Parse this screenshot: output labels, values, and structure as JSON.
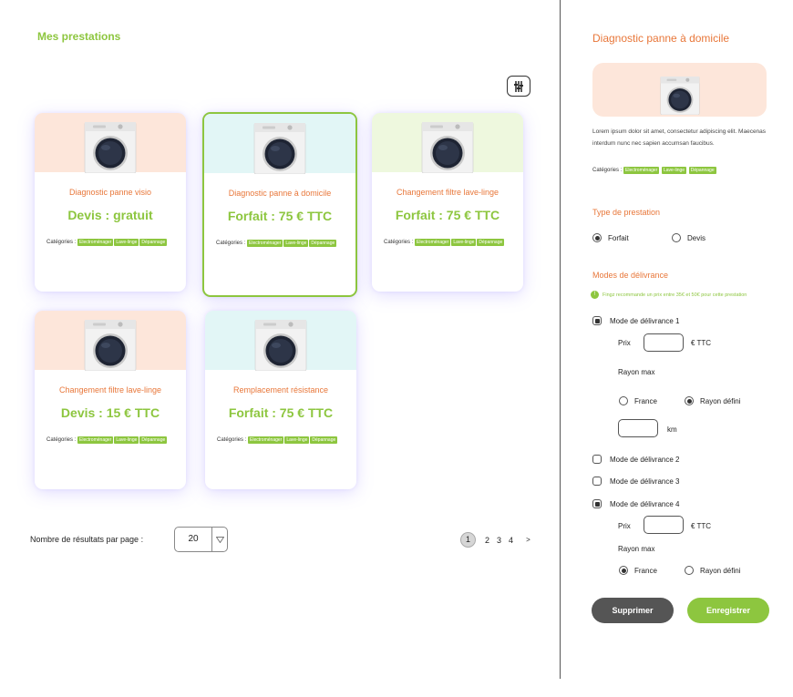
{
  "main": {
    "title": "Mes prestations",
    "filter_icon": "filter-sliders-icon",
    "cards": [
      {
        "name": "Diagnostic panne visio",
        "price": "Devis : gratuit",
        "cats_label": "Catégories :",
        "tags": [
          "Electroménager",
          "Lave-linge",
          "Dépannage"
        ],
        "header_color": "#fde6da",
        "selected": false
      },
      {
        "name": "Diagnostic panne à domicile",
        "price": "Forfait : 75 € TTC",
        "cats_label": "Catégories :",
        "tags": [
          "Electroménager",
          "Lave-linge",
          "Dépannage"
        ],
        "header_color": "#e2f6f6",
        "selected": true
      },
      {
        "name": "Changement filtre lave-linge",
        "price": "Forfait : 75 € TTC",
        "cats_label": "Catégories :",
        "tags": [
          "Electroménager",
          "Lave-linge",
          "Dépannage"
        ],
        "header_color": "#eef8de",
        "selected": false
      },
      {
        "name": "Changement filtre lave-linge",
        "price": "Devis : 15 € TTC",
        "cats_label": "Catégories :",
        "tags": [
          "Electroménager",
          "Lave-linge",
          "Dépannage"
        ],
        "header_color": "#fde6da",
        "selected": false
      },
      {
        "name": "Remplacement résistance",
        "price": "Forfait : 75 € TTC",
        "cats_label": "Catégories :",
        "tags": [
          "Electroménager",
          "Lave-linge",
          "Dépannage"
        ],
        "header_color": "#e2f6f6",
        "selected": false
      }
    ],
    "results_label": "Nombre de résultats par page :",
    "results_value": "20",
    "pagination": {
      "pages": [
        "1",
        "2",
        "3",
        "4"
      ],
      "current": "1",
      "next": ">"
    }
  },
  "side": {
    "title": "Diagnostic panne à domicile",
    "desc": "Lorem ipsum dolor sit amet, consectetur adipiscing elit. Maecenas interdum nunc nec sapien accumsan faucibus.",
    "cats_label": "Catégories :",
    "tags": [
      "Electroménager",
      "Lave-linge",
      "Dépannage"
    ],
    "type_title": "Type de prestation",
    "type_options": [
      "Forfait",
      "Devis"
    ],
    "type_selected": "Forfait",
    "modes_title": "Modes de délivrance",
    "hint": "Fingz recommande un prix entre 35€ et 50€ pour cette prestation",
    "mode1": "Mode de délivrance 1",
    "mode2": "Mode de délivrance 2",
    "mode3": "Mode de délivrance 3",
    "mode4": "Mode de délivrance 4",
    "prix": "Prix",
    "ttc": "€ TTC",
    "rayon_max": "Rayon max",
    "france": "France",
    "rayon_defini": "Rayon défini",
    "km": "km",
    "delete_label": "Supprimer",
    "save_label": "Enregistrer"
  },
  "colors": {
    "accent_green": "#8dc63f",
    "accent_orange": "#e8773a"
  }
}
